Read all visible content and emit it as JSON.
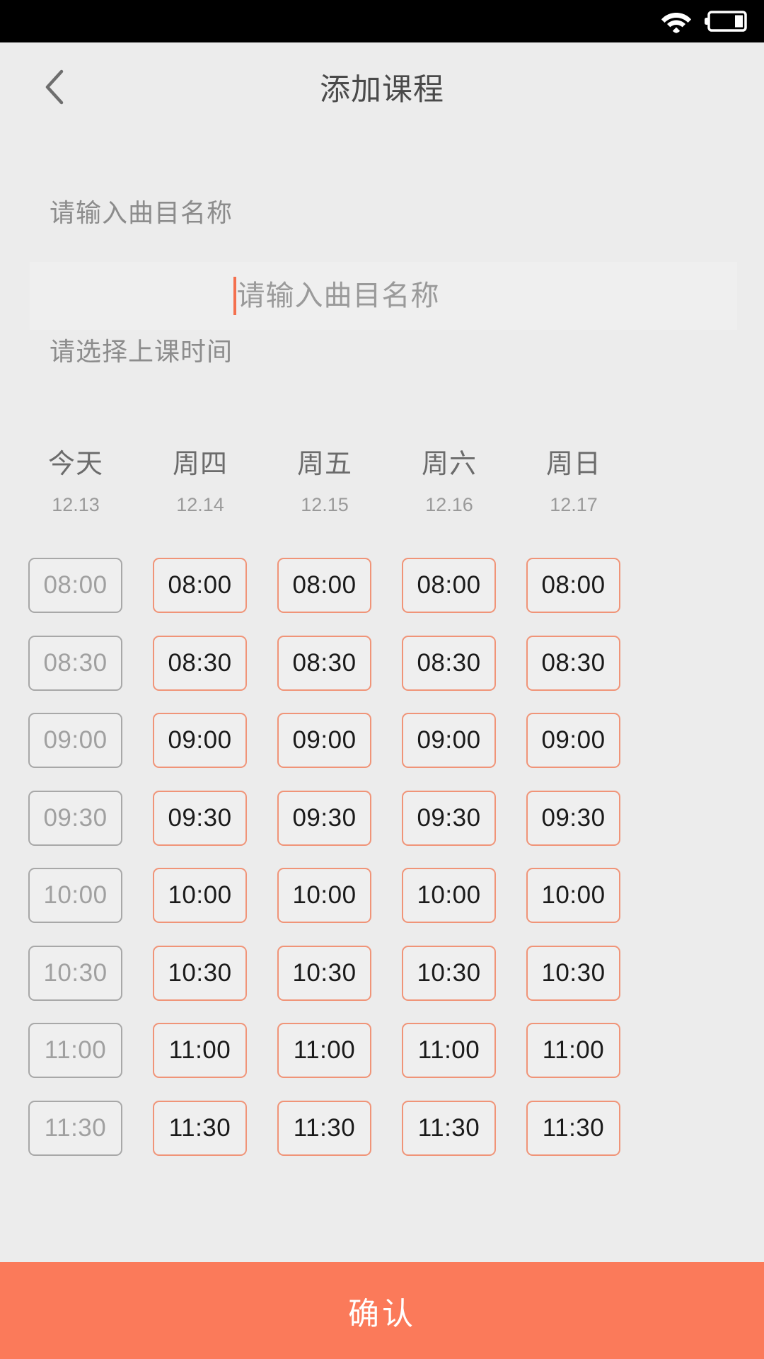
{
  "statusbar": {
    "wifi_icon": "wifi-icon",
    "battery_icon": "battery-icon",
    "battery_level_pct": 25
  },
  "navbar": {
    "back_icon": "chevron-left-icon",
    "title": "添加课程"
  },
  "form": {
    "song_label": "请输入曲目名称",
    "song_value": "",
    "song_placeholder": "请输入曲目名称",
    "time_label": "请选择上课时间"
  },
  "colors": {
    "page_bg": "#ECECEC",
    "accent": "#FB7A5A",
    "slot_border_available": "#F09478",
    "slot_border_disabled": "#A8A8A8",
    "caret": "#F4704E",
    "text_muted": "#8c8c8c"
  },
  "schedule": {
    "days": [
      {
        "name": "今天",
        "date": "12.13",
        "disabled": true
      },
      {
        "name": "周四",
        "date": "12.14",
        "disabled": false
      },
      {
        "name": "周五",
        "date": "12.15",
        "disabled": false
      },
      {
        "name": "周六",
        "date": "12.16",
        "disabled": false
      },
      {
        "name": "周日",
        "date": "12.17",
        "disabled": false
      }
    ],
    "times": [
      "08:00",
      "08:30",
      "09:00",
      "09:30",
      "10:00",
      "10:30",
      "11:00",
      "11:30"
    ]
  },
  "footer": {
    "confirm_label": "确认"
  }
}
